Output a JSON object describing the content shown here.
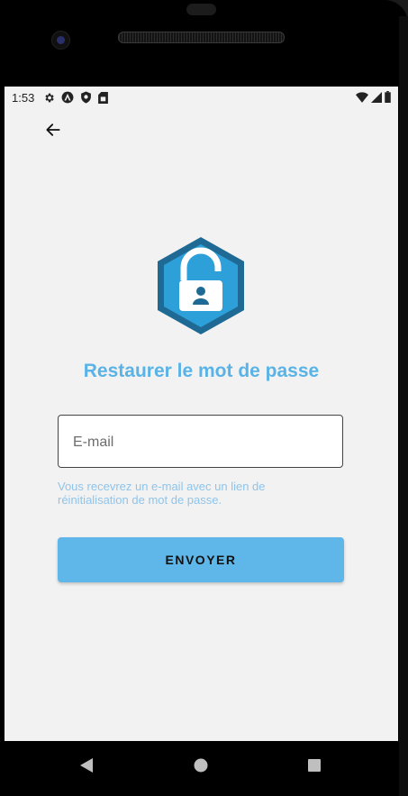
{
  "status_bar": {
    "time": "1:53",
    "left_icons": [
      "settings-icon",
      "accessibility-icon",
      "shield-icon",
      "sim-card-icon"
    ],
    "right_icons": [
      "wifi-icon",
      "signal-icon",
      "battery-icon"
    ]
  },
  "header": {
    "back_icon": "arrow-left-icon"
  },
  "main": {
    "lock_icon": "padlock-open-icon",
    "title": "Restaurer le mot de passe",
    "email_placeholder": "E-mail",
    "email_value": "",
    "helper_text": "Vous recevrez un e-mail avec un lien de réinitialisation de mot de passe.",
    "submit_label": "ENVOYER"
  },
  "nav_bar": {
    "buttons": [
      "back-triangle-icon",
      "home-circle-icon",
      "recents-square-icon"
    ]
  },
  "colors": {
    "accent": "#5ab3e6",
    "button": "#5fb6e8",
    "helper": "#8fc4ea",
    "lock_dark": "#1f6a94",
    "lock_light": "#2d9fd9",
    "screen_bg": "#f2f2f2"
  }
}
